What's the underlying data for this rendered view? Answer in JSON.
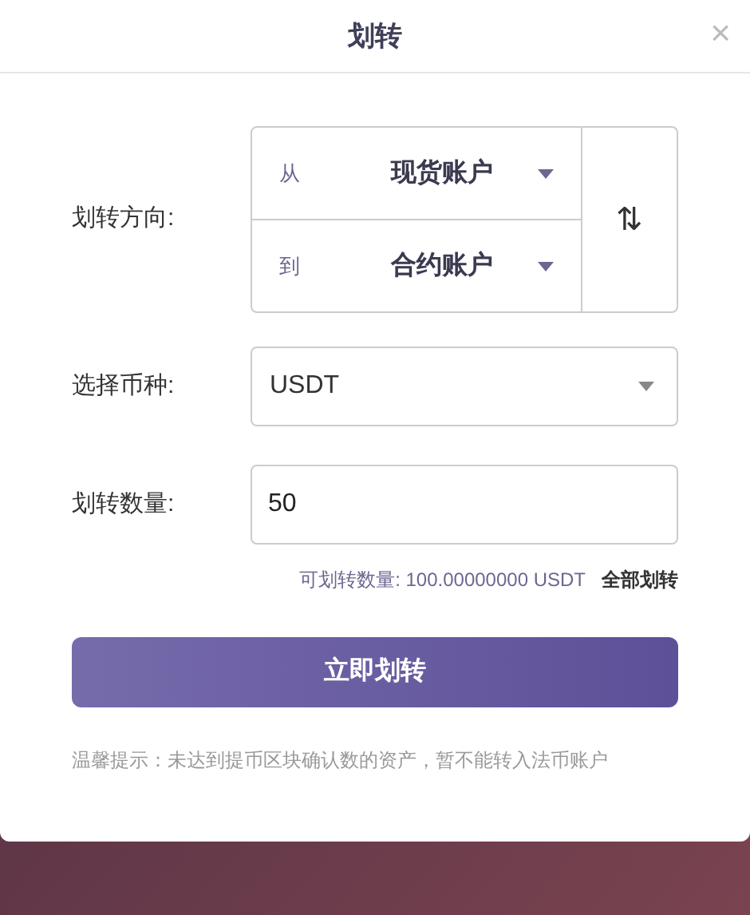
{
  "dialog": {
    "title": "划转",
    "close": "×"
  },
  "direction": {
    "label": "划转方向:",
    "rows": [
      {
        "prefix": "从",
        "value": "现货账户"
      },
      {
        "prefix": "到",
        "value": "合约账户"
      }
    ],
    "swap": "⇅"
  },
  "currency": {
    "label": "选择币种:",
    "value": "USDT"
  },
  "amount": {
    "label": "划转数量:",
    "value": "50"
  },
  "available": {
    "text": "可划转数量: 100.00000000 USDT",
    "all_link": "全部划转"
  },
  "submit": "立即划转",
  "notice": "温馨提示：未达到提币区块确认数的资产，暂不能转入法币账户"
}
